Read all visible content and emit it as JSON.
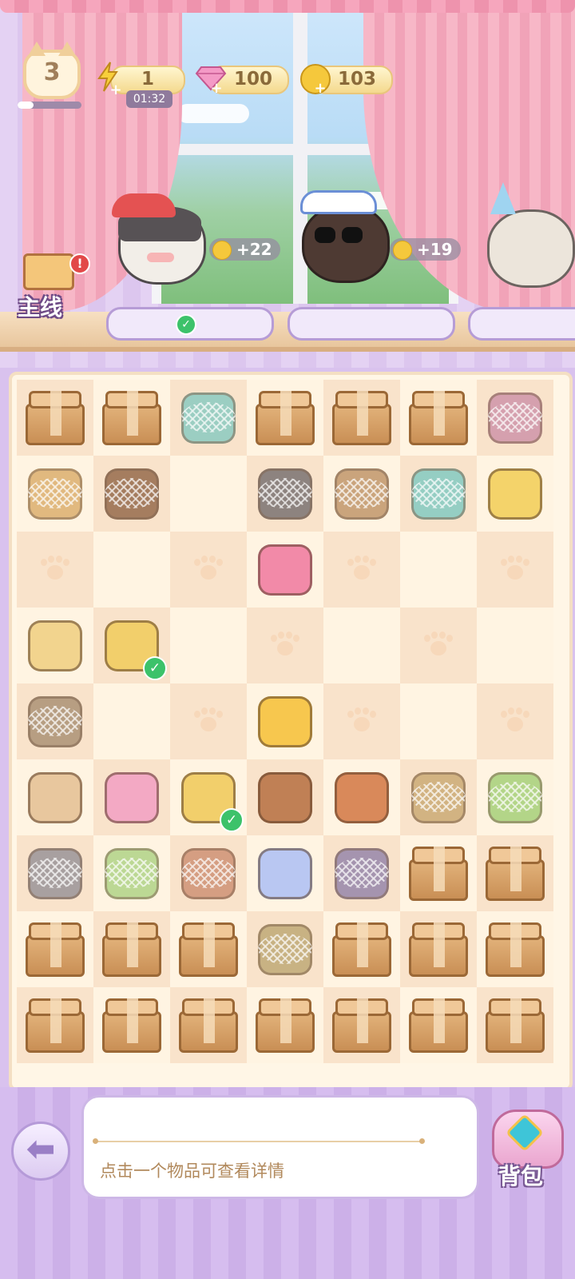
{
  "hud": {
    "level": "3",
    "level_progress": 0.25,
    "energy": {
      "value": "1",
      "timer": "01:32"
    },
    "gems": {
      "value": "100"
    },
    "coins": {
      "value": "103"
    }
  },
  "quest": {
    "label": "主线",
    "alert": "!"
  },
  "customers": [
    {
      "name": "pirate-cat",
      "reward": "+22",
      "order_done": true
    },
    {
      "name": "maid-cat",
      "reward": "+19",
      "order_done": false
    },
    {
      "name": "party-cat",
      "reward": "",
      "order_done": false
    }
  ],
  "board": {
    "rows": [
      [
        "box",
        "box",
        "drawer-web",
        "box",
        "box",
        "box",
        "clothes-rack-web"
      ],
      [
        "flower-web",
        "bowl-web",
        "empty",
        "cat-web",
        "shovel-web",
        "teal-bowl-web",
        "candelabra"
      ],
      [
        "paw",
        "empty",
        "paw",
        "pink-pillow",
        "paw",
        "empty",
        "paw"
      ],
      [
        "gold-dress",
        "yellow-dress-check",
        "empty",
        "paw",
        "empty",
        "paw",
        "empty"
      ],
      [
        "cat-bed-web",
        "empty",
        "paw",
        "tea-cup",
        "paw",
        "empty",
        "paw"
      ],
      [
        "parfait",
        "pink-rack",
        "yellow-dress-check",
        "coffee-cup",
        "coffee-maker",
        "cake-web",
        "fruit-cake-web"
      ],
      [
        "grey-hat-web",
        "fruit-tart-web",
        "toaster-web",
        "blue-jacket",
        "purple-bed-web",
        "box",
        "box"
      ],
      [
        "box",
        "box",
        "box",
        "round-bed-web",
        "box",
        "box",
        "box"
      ],
      [
        "box",
        "box",
        "box",
        "box",
        "box",
        "box",
        "box"
      ]
    ]
  },
  "bottom": {
    "back_icon": "arrow-left-icon",
    "hint": "点击一个物品可查看详情",
    "bag_label": "背包"
  },
  "colors": {
    "accent": "#b69cd6",
    "coin": "#f5c83c",
    "check": "#3cc26a"
  }
}
